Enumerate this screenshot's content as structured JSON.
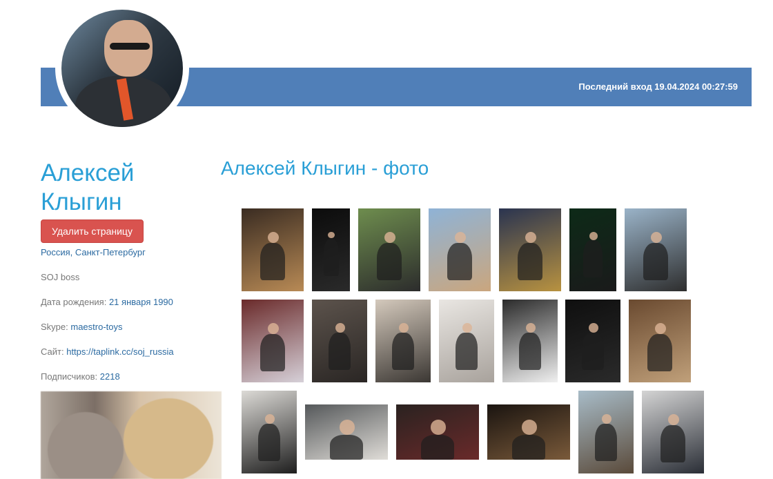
{
  "header": {
    "last_login_label": "Последний вход",
    "last_login_value": "19.04.2024 00:27:59"
  },
  "profile": {
    "name": "Алексей Клыгин",
    "delete_button": "Удалить страницу",
    "location": "Россия, Санкт-Петербург",
    "status": "SOJ boss",
    "birthday_label": "Дата рождения:",
    "birthday_value": "21 января 1990",
    "skype_label": "Skype:",
    "skype_value": "maestro-toys",
    "site_label": "Сайт:",
    "site_value": "https://taplink.cc/soj_russia",
    "followers_label": "Подписчиков:",
    "followers_value": "2218"
  },
  "photos": {
    "title": "Алексей Клыгин - фото",
    "rows": [
      [
        {
          "colors": [
            "#3a2c22",
            "#b88a55"
          ]
        },
        {
          "colors": [
            "#0c0c0c",
            "#2a2a2a"
          ]
        },
        {
          "colors": [
            "#6e8d4e",
            "#2c2c2c"
          ]
        },
        {
          "colors": [
            "#8fb3d6",
            "#caa67e"
          ]
        },
        {
          "colors": [
            "#2a3450",
            "#b89240"
          ]
        },
        {
          "colors": [
            "#0d2a18",
            "#1a1a1a"
          ]
        },
        {
          "colors": [
            "#9ab3c8",
            "#2e2e2e"
          ]
        }
      ],
      [
        {
          "colors": [
            "#6a2a2a",
            "#d6d0d8"
          ]
        },
        {
          "colors": [
            "#5c534c",
            "#2a2624"
          ]
        },
        {
          "colors": [
            "#d4c9bc",
            "#3b3733"
          ]
        },
        {
          "colors": [
            "#e9e6e2",
            "#a8a29c"
          ]
        },
        {
          "colors": [
            "#2b2b2b",
            "#f0f0f0"
          ]
        },
        {
          "colors": [
            "#0f0f0f",
            "#2a2a2a"
          ]
        },
        {
          "colors": [
            "#6a4a30",
            "#c0a07a"
          ]
        }
      ],
      [
        {
          "colors": [
            "#dcdad6",
            "#1e1e1e"
          ]
        },
        {
          "colors": [
            "#55585a",
            "#e0ddd8"
          ]
        },
        {
          "colors": [
            "#2a2220",
            "#6a2a2a"
          ]
        },
        {
          "colors": [
            "#1a1410",
            "#7a5a3a"
          ]
        },
        {
          "colors": [
            "#a8bcc8",
            "#5a4a3a"
          ]
        },
        {
          "colors": [
            "#d4d4d4",
            "#2a2e36"
          ]
        }
      ]
    ]
  }
}
